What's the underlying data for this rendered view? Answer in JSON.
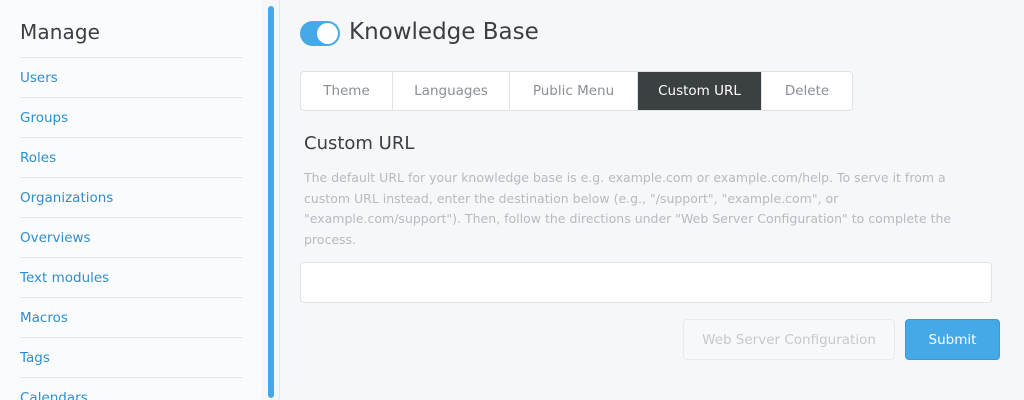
{
  "sidebar": {
    "title": "Manage",
    "items": [
      {
        "label": "Users"
      },
      {
        "label": "Groups"
      },
      {
        "label": "Roles"
      },
      {
        "label": "Organizations"
      },
      {
        "label": "Overviews"
      },
      {
        "label": "Text modules"
      },
      {
        "label": "Macros"
      },
      {
        "label": "Tags"
      },
      {
        "label": "Calendars"
      }
    ]
  },
  "header": {
    "title": "Knowledge Base",
    "toggle_enabled": true
  },
  "tabs": [
    {
      "label": "Theme",
      "active": false
    },
    {
      "label": "Languages",
      "active": false
    },
    {
      "label": "Public Menu",
      "active": false
    },
    {
      "label": "Custom URL",
      "active": true
    },
    {
      "label": "Delete",
      "active": false
    }
  ],
  "custom_url": {
    "title": "Custom URL",
    "description": "The default URL for your knowledge base is e.g. example.com or example.com/help. To serve it from a custom URL instead, enter the destination below (e.g., \"/support\", \"example.com\", or \"example.com/support\"). Then, follow the directions under \"Web Server Configuration\" to complete the process.",
    "input_value": "",
    "web_server_button": "Web Server Configuration",
    "submit_button": "Submit"
  },
  "colors": {
    "accent": "#45a9e8",
    "link": "#2f8dcf",
    "active_tab": "#3b4043"
  }
}
